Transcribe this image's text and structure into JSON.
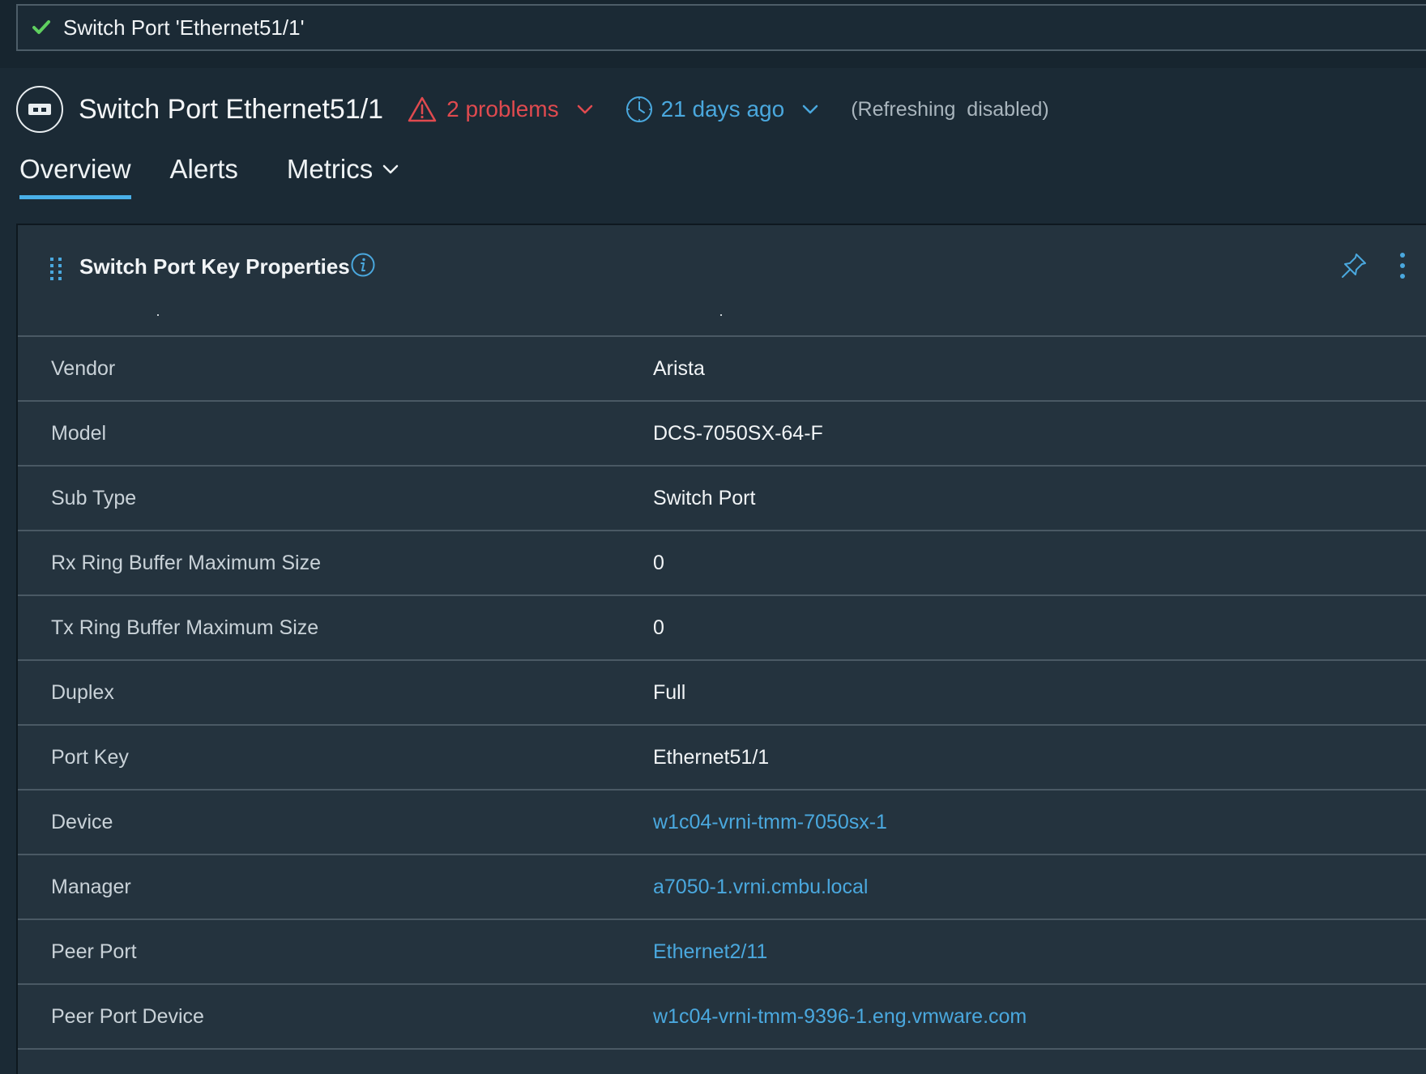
{
  "breadcrumb": {
    "text": "Switch Port 'Ethernet51/1'"
  },
  "header": {
    "title": "Switch Port Ethernet51/1",
    "problems_label": "2 problems",
    "time_label": "21 days ago",
    "refresh_status": "(Refreshing  disabled)"
  },
  "tabs": [
    {
      "label": "Overview"
    },
    {
      "label": "Alerts"
    },
    {
      "label": "Metrics"
    }
  ],
  "card": {
    "title": "Switch Port Key Properties",
    "rows": [
      {
        "label": "Vendor",
        "value": "Arista"
      },
      {
        "label": "Model",
        "value": "DCS-7050SX-64-F"
      },
      {
        "label": "Sub Type",
        "value": "Switch Port"
      },
      {
        "label": "Rx Ring Buffer Maximum Size",
        "value": "0"
      },
      {
        "label": "Tx Ring Buffer Maximum Size",
        "value": "0"
      },
      {
        "label": "Duplex",
        "value": "Full"
      },
      {
        "label": "Port Key",
        "value": "Ethernet51/1"
      },
      {
        "label": "Device",
        "value": "w1c04-vrni-tmm-7050sx-1"
      },
      {
        "label": "Manager",
        "value": "a7050-1.vrni.cmbu.local"
      },
      {
        "label": "Peer Port",
        "value": "Ethernet2/11"
      },
      {
        "label": "Peer Port Device",
        "value": "w1c04-vrni-tmm-9396-1.eng.vmware.com"
      }
    ]
  },
  "colors": {
    "background": "#1b2a35",
    "card": "#24333e",
    "link": "#4aa8de",
    "danger": "#e04a4f",
    "success": "#5fcf5f",
    "tab_underline": "#49b0e8"
  },
  "icons": {
    "breadcrumb": "check-icon",
    "object": "switch-port-icon",
    "problems": "warning-triangle-icon",
    "time": "clock-icon",
    "card_grip": "drag-handle-icon",
    "card_info": "info-icon",
    "card_pin": "pin-icon",
    "card_menu": "kebab-menu-icon"
  }
}
